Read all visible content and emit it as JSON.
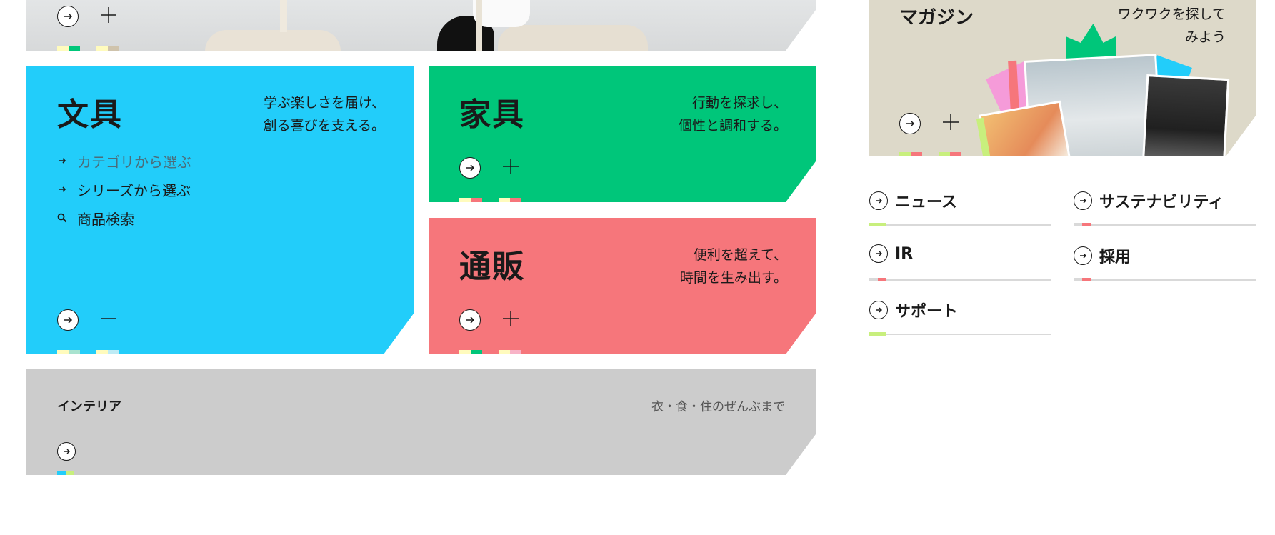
{
  "colors": {
    "stationery": "#22cdfa",
    "furniture": "#00c67a",
    "mailorder": "#f6767b",
    "interior": "#cccccc",
    "magazine": "#ddd9c9"
  },
  "cards": {
    "stationery": {
      "title": "文具",
      "tagline_1": "学ぶ楽しさを届け、",
      "tagline_2": "創る喜びを支える。",
      "menu": [
        {
          "label": "カテゴリから選ぶ",
          "icon": "arrow-right-icon"
        },
        {
          "label": "シリーズから選ぶ",
          "icon": "arrow-right-icon"
        },
        {
          "label": "商品検索",
          "icon": "search-icon"
        }
      ]
    },
    "furniture": {
      "title": "家具",
      "tagline_1": "行動を探求し、",
      "tagline_2": "個性と調和する。"
    },
    "mailorder": {
      "title": "通販",
      "tagline_1": "便利を超えて、",
      "tagline_2": "時間を生み出す。"
    },
    "interior": {
      "title": "インテリア",
      "tagline": "衣・食・住のぜんぶまで"
    },
    "magazine": {
      "title": "マガジン",
      "tagline_1": "ワクワクを探して",
      "tagline_2": "みよう"
    }
  },
  "links": [
    {
      "label": "ニュース",
      "accent": "#c8ef7d"
    },
    {
      "label": "サステナビリティ",
      "accent": "#f6767b"
    },
    {
      "label": "IR",
      "accent": "#f6767b"
    },
    {
      "label": "採用",
      "accent": "#f6767b"
    },
    {
      "label": "サポート",
      "accent": "#c8ef7d"
    }
  ]
}
